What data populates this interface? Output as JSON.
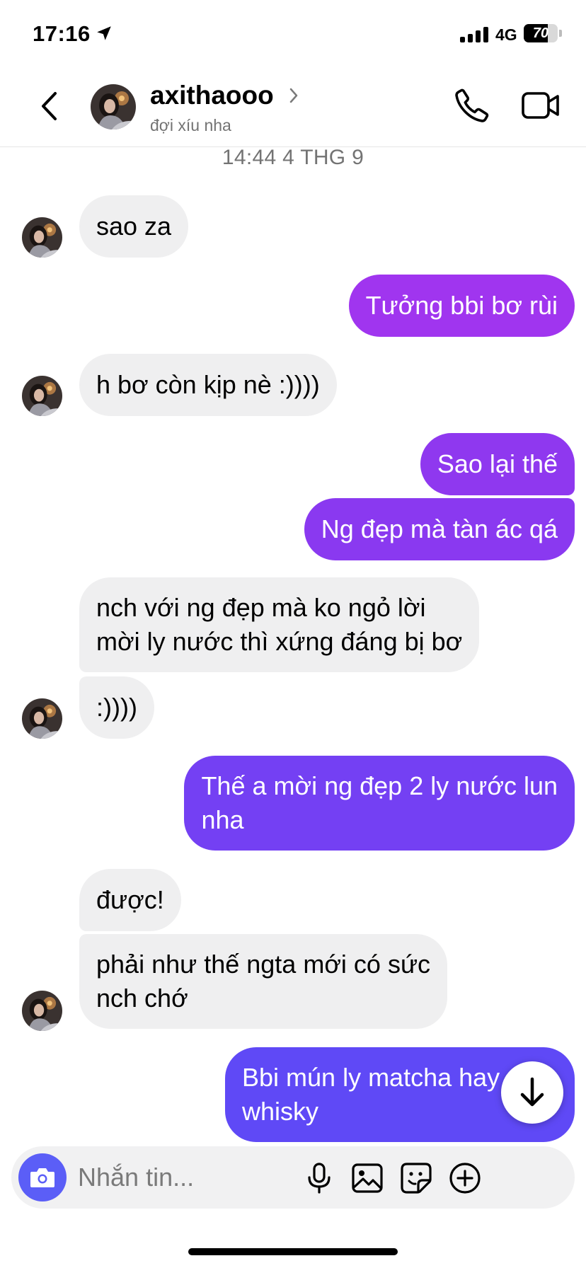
{
  "status_bar": {
    "time": "17:16",
    "network": "4G",
    "battery_label": "70",
    "battery_level": 0.7
  },
  "header": {
    "name": "axithaooo",
    "status": "đợi xíu nha"
  },
  "timestamp": "14:44 4 THG 9",
  "messages": [
    {
      "sender": "them",
      "lines": [
        "sao za"
      ]
    },
    {
      "sender": "me",
      "lines": [
        "Tưởng bbi bơ rùi"
      ]
    },
    {
      "sender": "them",
      "lines": [
        "h bơ còn kịp nè :))))"
      ]
    },
    {
      "sender": "me",
      "lines": [
        "Sao lại thế"
      ]
    },
    {
      "sender": "me",
      "lines": [
        "Ng đẹp mà tàn ác qá"
      ]
    },
    {
      "sender": "them",
      "lines": [
        "nch với ng đẹp mà ko ngỏ lời",
        "mời ly nước thì xứng đáng bị bơ"
      ]
    },
    {
      "sender": "them",
      "lines": [
        ":))))"
      ]
    },
    {
      "sender": "me",
      "lines": [
        "Thế a mời ng đẹp 2 ly nước lun",
        "nha"
      ]
    },
    {
      "sender": "them",
      "lines": [
        "được!"
      ]
    },
    {
      "sender": "them",
      "lines": [
        "phải như thế ngta mới có sức",
        "nch chớ"
      ]
    },
    {
      "sender": "me",
      "lines": [
        "Bbi mún ly matcha hay",
        "whisky"
      ]
    }
  ],
  "composer": {
    "placeholder": "Nhắn tin..."
  },
  "colors": {
    "incoming_bubble": "#efeff0",
    "outgoing_gradient": [
      "#a035ef",
      "#8f38ef",
      "#7c3cf2",
      "#6f40f4",
      "#5f49f6"
    ],
    "accent": "#5b5ef7"
  },
  "icons": {
    "back": "chevron-left-icon",
    "call": "phone-icon",
    "video": "video-camera-icon",
    "camera": "camera-icon",
    "mic": "microphone-icon",
    "gallery": "image-icon",
    "sticker": "sticker-icon",
    "more": "plus-circle-icon",
    "scroll": "arrow-down-icon"
  }
}
